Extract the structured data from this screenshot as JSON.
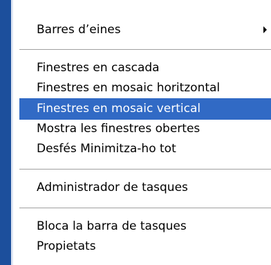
{
  "menu": {
    "items": [
      {
        "label": "Barres d’eines",
        "has_submenu": true
      },
      {
        "label": "Finestres en cascada"
      },
      {
        "label": "Finestres en mosaic horitzontal"
      },
      {
        "label": "Finestres en mosaic vertical",
        "selected": true
      },
      {
        "label": "Mostra les finestres obertes"
      },
      {
        "label": "Desfés Minimitza-ho tot"
      },
      {
        "label": "Administrador de tasques"
      },
      {
        "label": "Bloca la barra de tasques"
      },
      {
        "label": "Propietats"
      }
    ]
  },
  "colors": {
    "selection_bg": "#316ac5",
    "selection_text": "#ffffff",
    "side_strip": "#1c4f9c",
    "separator": "#a0a0a0"
  }
}
